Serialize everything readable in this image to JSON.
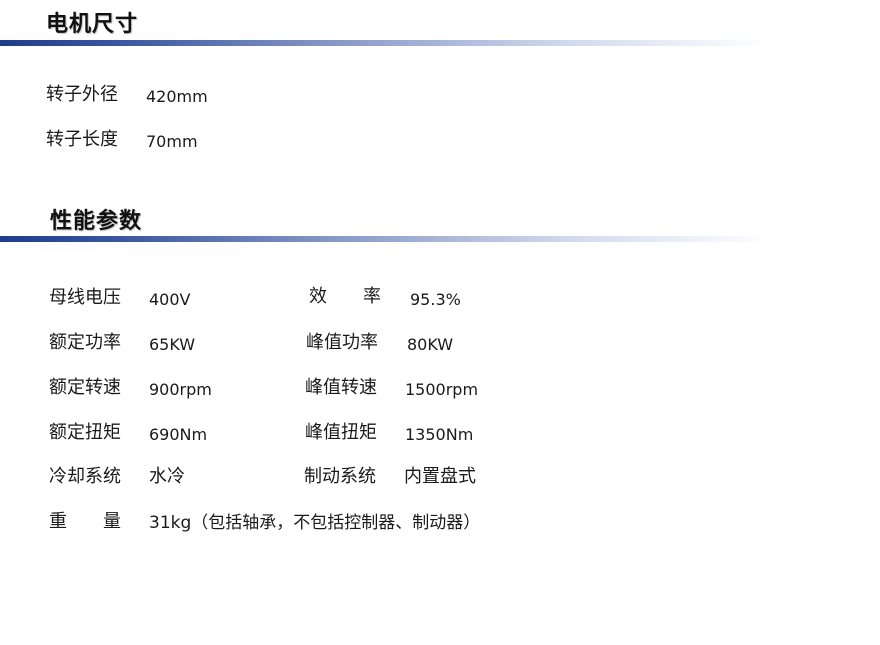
{
  "sections": [
    {
      "title": "电机尺寸",
      "rows": [
        {
          "label": "转子外径",
          "value": "420mm"
        },
        {
          "label": "转子长度",
          "value": "70mm"
        }
      ]
    },
    {
      "title": "性能参数",
      "left": [
        {
          "label": "母线电压",
          "value": "400V"
        },
        {
          "label": "额定功率",
          "value": "65KW"
        },
        {
          "label": "额定转速",
          "value": "900rpm"
        },
        {
          "label": "额定扭矩",
          "value": "690Nm"
        },
        {
          "label": "冷却系统",
          "value": "水冷"
        },
        {
          "label": "重　　量",
          "value": "31kg（包括轴承，不包括控制器、制动器）"
        }
      ],
      "right": [
        {
          "label": "效　　率",
          "value": "95.3%"
        },
        {
          "label": "峰值功率",
          "value": "80KW"
        },
        {
          "label": "峰值转速",
          "value": "1500rpm"
        },
        {
          "label": "峰值扭矩",
          "value": "1350Nm"
        },
        {
          "label": "制动系统",
          "value": "内置盘式"
        }
      ]
    }
  ],
  "colors": {
    "rule_start": "#1f3b8c",
    "text": "#1a1a1a"
  }
}
